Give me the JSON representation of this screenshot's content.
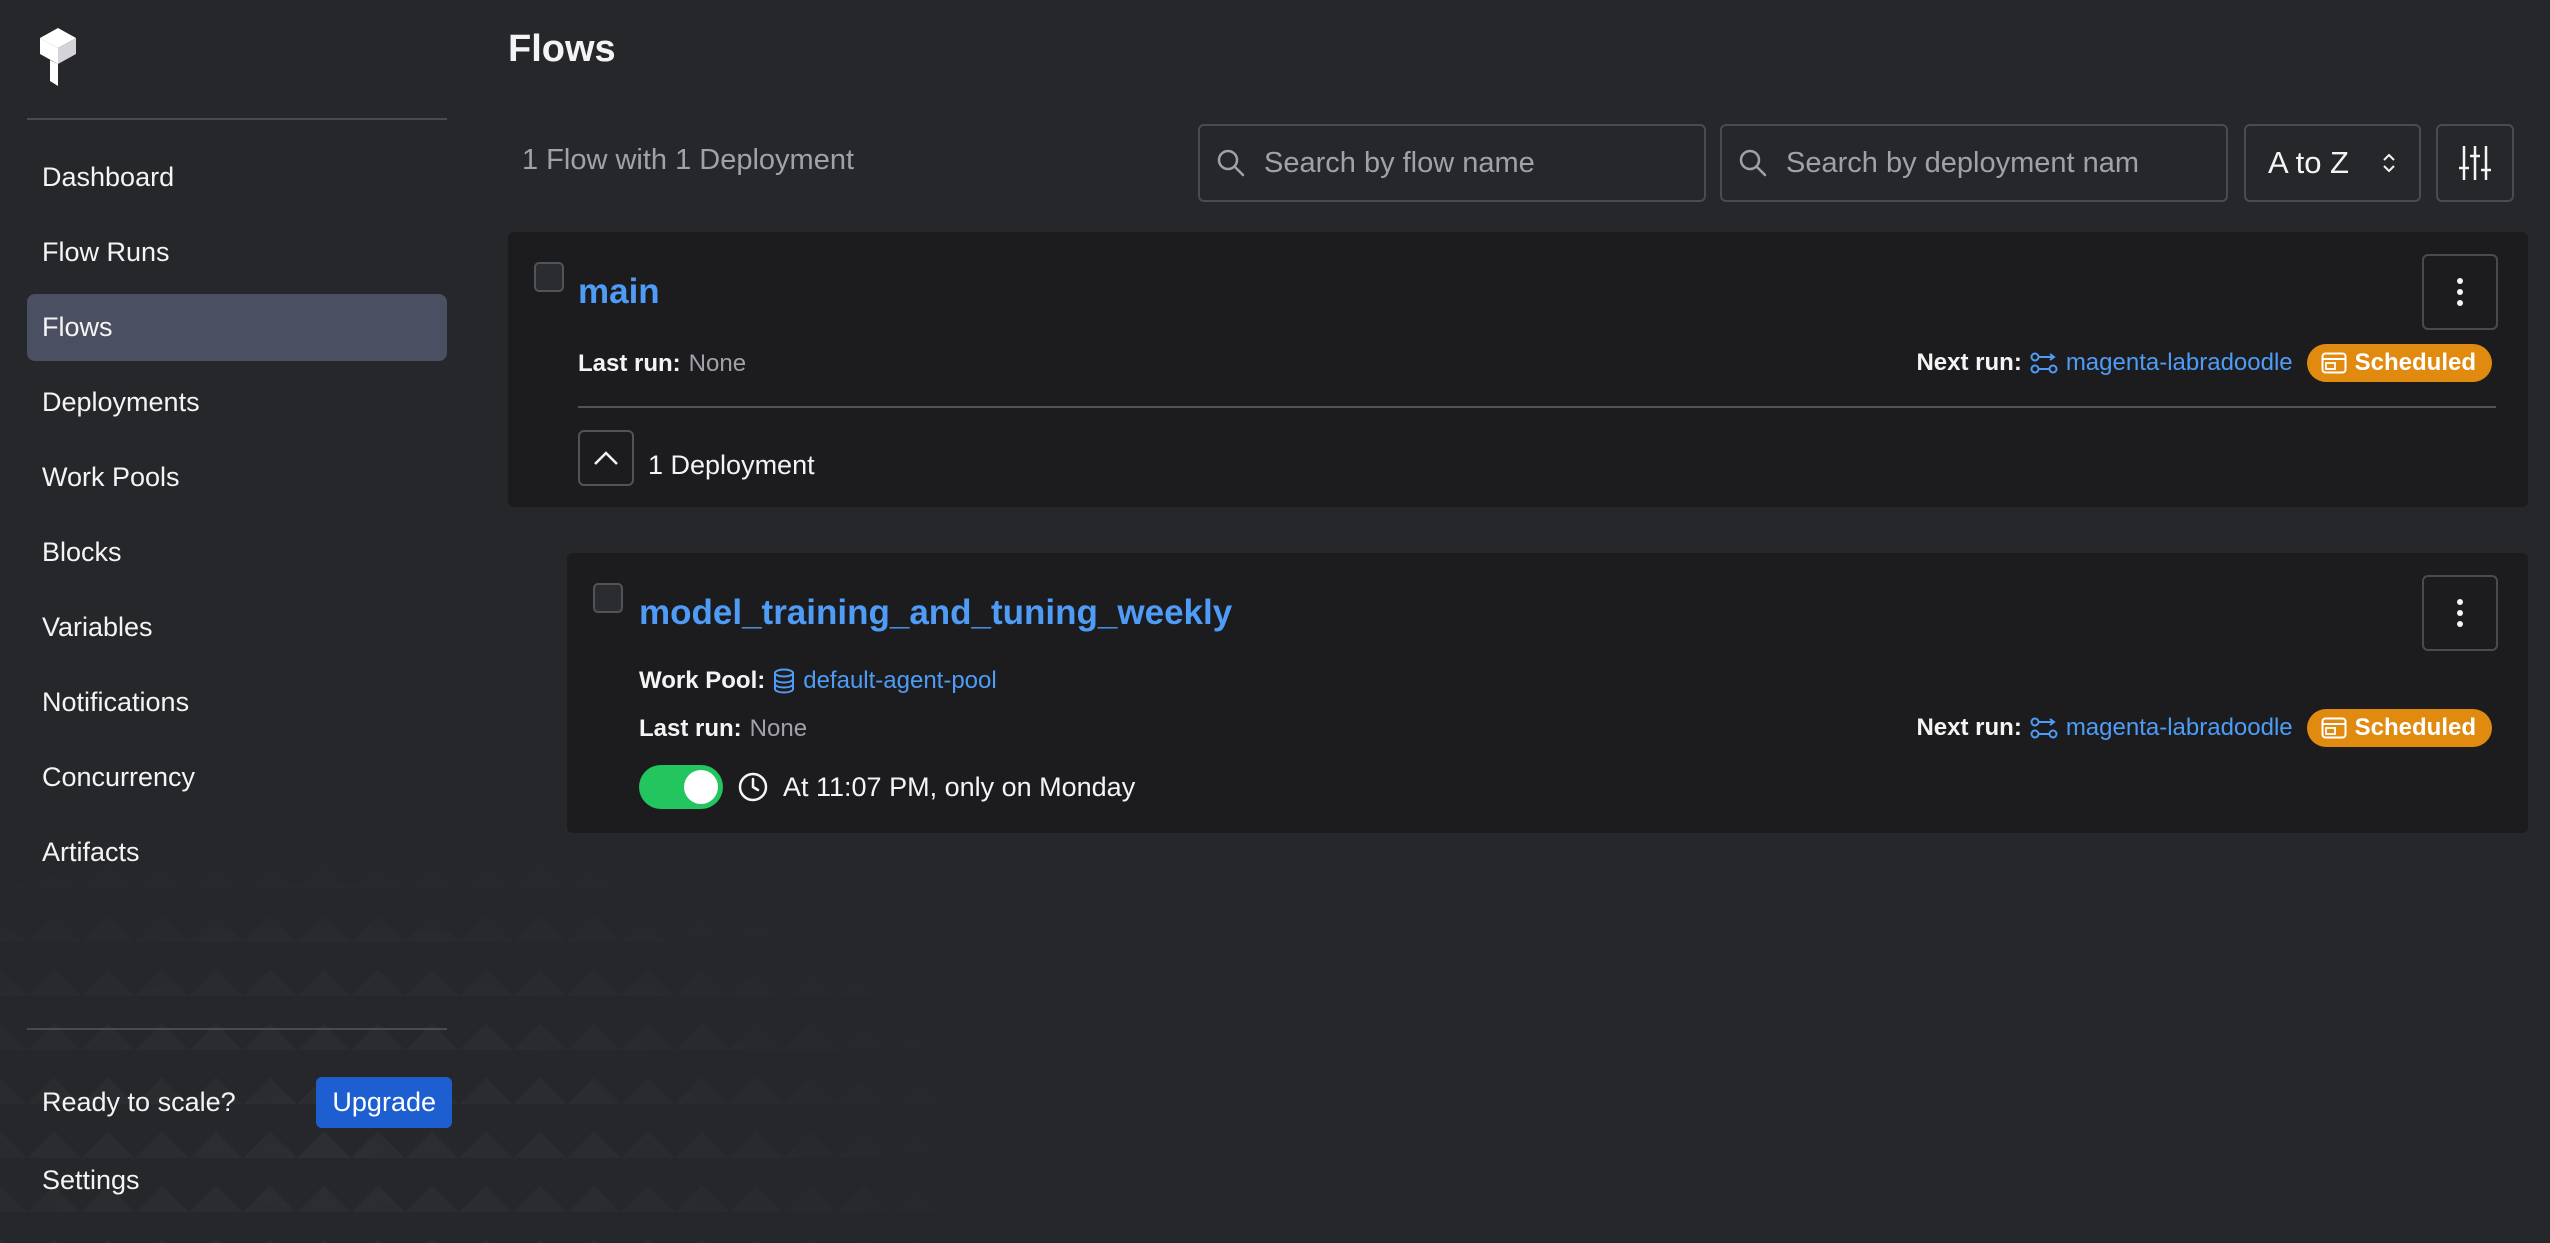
{
  "sidebar": {
    "items": [
      {
        "label": "Dashboard"
      },
      {
        "label": "Flow Runs"
      },
      {
        "label": "Flows"
      },
      {
        "label": "Deployments"
      },
      {
        "label": "Work Pools"
      },
      {
        "label": "Blocks"
      },
      {
        "label": "Variables"
      },
      {
        "label": "Notifications"
      },
      {
        "label": "Concurrency"
      },
      {
        "label": "Artifacts"
      }
    ],
    "active": "Flows",
    "upgrade_prompt": "Ready to scale?",
    "upgrade_label": "Upgrade",
    "settings_label": "Settings"
  },
  "header": {
    "title": "Flows",
    "summary": "1 Flow with 1 Deployment",
    "search_flow_placeholder": "Search by flow name",
    "search_deployment_placeholder": "Search by deployment nam",
    "sort_label": "A to Z"
  },
  "flows": [
    {
      "name": "main",
      "last_run_label": "Last run:",
      "last_run_value": "None",
      "next_run_label": "Next run:",
      "next_run_name": "magenta-labradoodle",
      "status": "Scheduled",
      "deployments_label": "1 Deployment",
      "deployment": {
        "name": "model_training_and_tuning_weekly",
        "work_pool_label": "Work Pool:",
        "work_pool_value": "default-agent-pool",
        "last_run_label": "Last run:",
        "last_run_value": "None",
        "next_run_label": "Next run:",
        "next_run_name": "magenta-labradoodle",
        "status": "Scheduled",
        "schedule_active": true,
        "schedule_text": "At 11:07 PM, only on Monday"
      }
    }
  ],
  "colors": {
    "background": "#26272b",
    "card": "#1c1c1f",
    "link": "#4e9cf5",
    "scheduled_badge": "#e08a10",
    "upgrade_button": "#1d5fd1",
    "toggle_on": "#22c55e",
    "nav_active": "#4a5061"
  },
  "icons": [
    "prefect-logo-icon",
    "search-icon",
    "chevron-updown-icon",
    "sliders-icon",
    "kebab-icon",
    "flow-run-icon",
    "calendar-icon",
    "chevron-up-icon",
    "database-icon",
    "clock-icon"
  ]
}
